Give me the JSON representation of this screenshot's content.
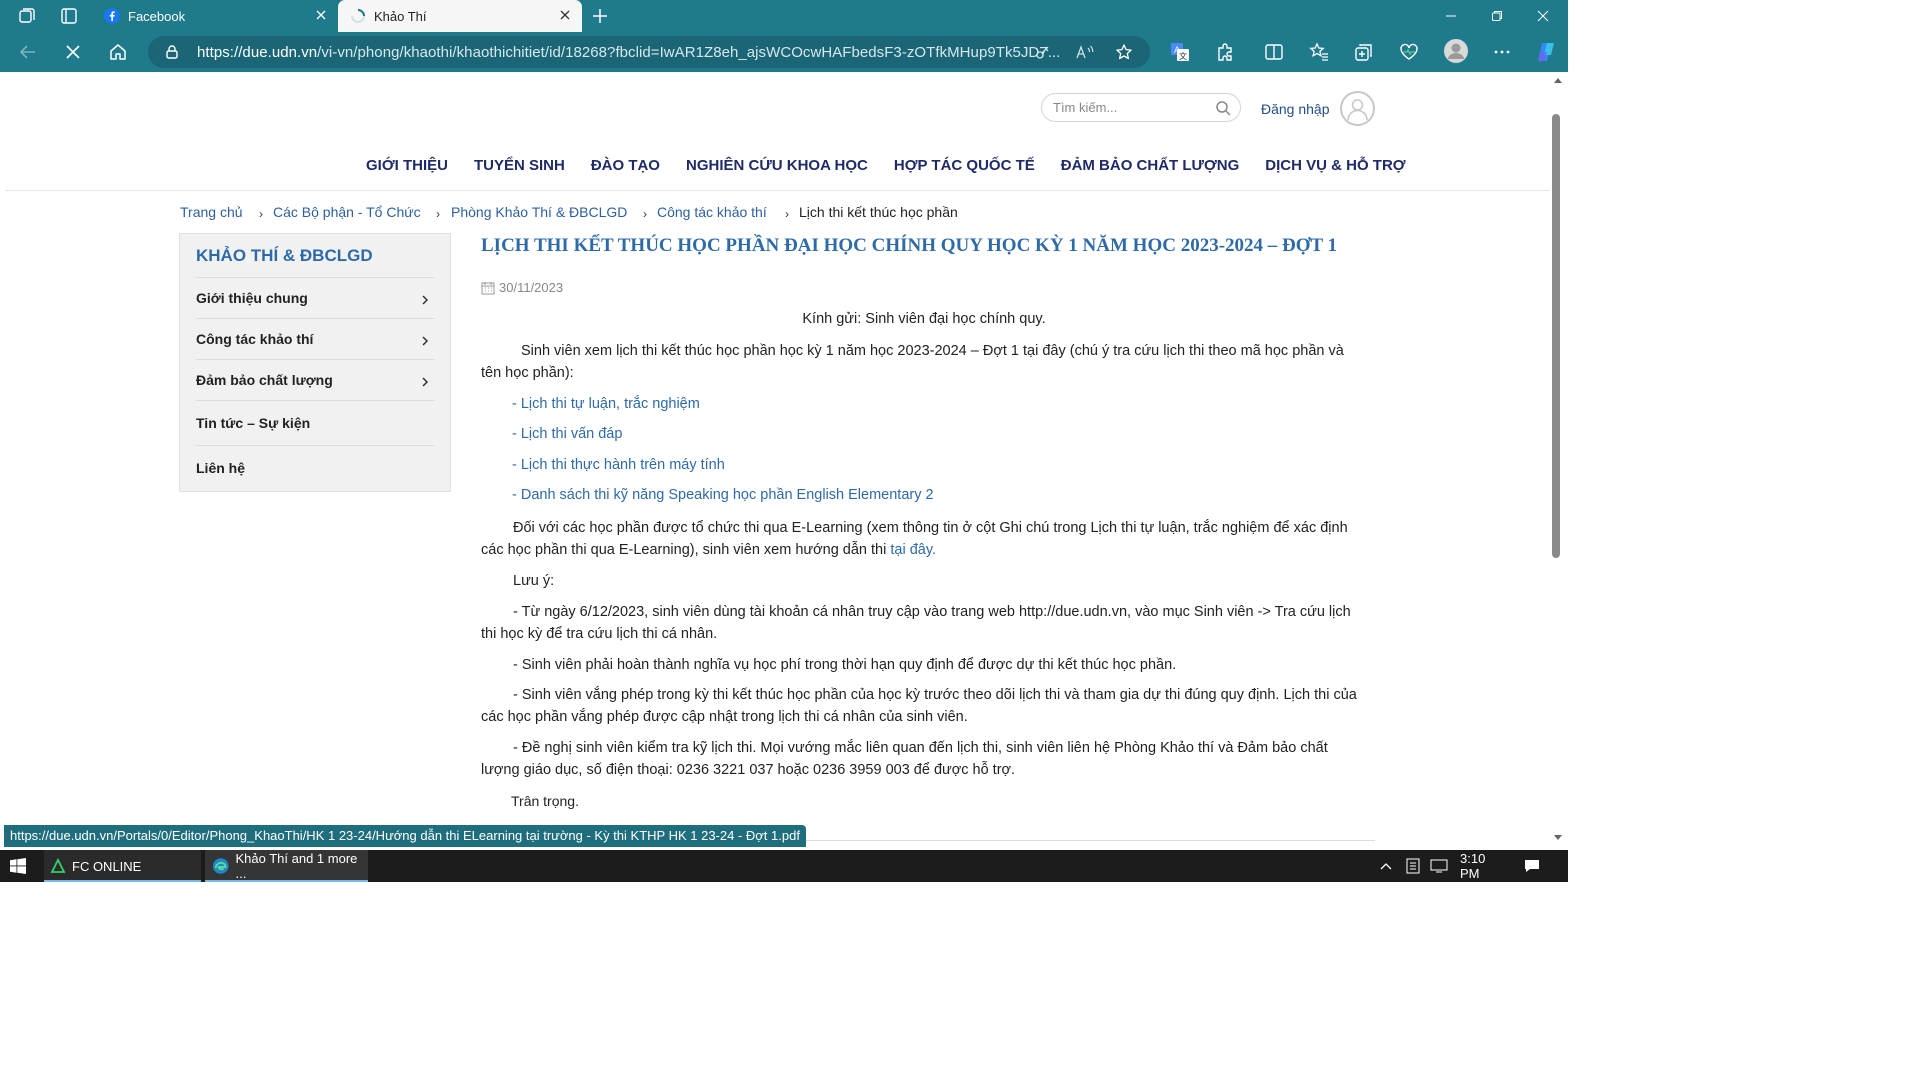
{
  "browser": {
    "tabs": [
      {
        "title": "Facebook"
      },
      {
        "title": "Khảo Thí"
      }
    ],
    "url_host": "https://due.udn.vn",
    "url_path": "/vi-vn/phong/khaothi/khaothichitiet/id/18268?fbclid=IwAR1Z8eh_ajsWCOcwHAFbedsF3-zOTfkMHup9Tk5JD7...",
    "status_url": "https://due.udn.vn/Portals/0/Editor/Phong_KhaoThi/HK 1 23-24/Hướng dẫn thi ELearning tại trường - Kỳ thi KTHP HK 1 23-24 - Đợt 1.pdf",
    "accent": "#1f7a8c"
  },
  "header": {
    "search_placeholder": "Tìm kiếm...",
    "login": "Đăng nhập",
    "menu": [
      "GIỚI THIỆU",
      "TUYỂN SINH",
      "ĐÀO TẠO",
      "NGHIÊN CỨU KHOA HỌC",
      "HỢP TÁC QUỐC TẾ",
      "ĐẢM BẢO CHẤT LƯỢNG",
      "DỊCH VỤ & HỖ TRỢ"
    ]
  },
  "breadcrumb": [
    "Trang chủ",
    "Các Bộ phận - Tổ Chức",
    "Phòng Khảo Thí & ĐBCLGD",
    "Công tác khảo thí",
    "Lịch thi kết thúc học phần"
  ],
  "sidebar": {
    "title": "KHẢO THÍ & ĐBCLGD",
    "items": [
      "Giới thiệu chung",
      "Công tác khảo thí",
      "Đảm bảo chất lượng",
      "Tin tức – Sự kiện",
      "Liên hệ"
    ]
  },
  "article": {
    "title": "LỊCH THI KẾT THÚC HỌC PHẦN ĐẠI HỌC CHÍNH QUY HỌC KỲ 1 NĂM HỌC 2023-2024 – ĐỢT 1",
    "date": "30/11/2023",
    "greeting": "Kính gửi: Sinh viên đại học chính quy.",
    "intro": "Sinh viên xem lịch thi kết thúc học phần học kỳ 1 năm học 2023-2024 – Đợt 1 tại đây (chú ý tra cứu lịch thi theo mã học phần và tên học phần):",
    "links": [
      "- Lịch thi tự luận, trắc nghiệm",
      "- Lịch thi vấn đáp",
      "- Lịch thi thực hành trên máy tính",
      "- Danh sách thi kỹ năng Speaking học phần English Elementary 2"
    ],
    "elearning_text": "Đối với các học phần được tổ chức thi qua E-Learning (xem thông tin ở cột Ghi chú trong Lịch thi tự luận, trắc nghiệm để xác định các học phần thi qua E-Learning), sinh viên xem hướng dẫn thi ",
    "elearning_link": "tại đây.",
    "note_label": "Lưu ý:",
    "notes": [
      "- Từ ngày 6/12/2023, sinh viên dùng tài khoản cá nhân truy cập vào trang web http://due.udn.vn, vào mục Sinh viên -> Tra cứu lịch thi học kỳ để tra cứu lịch thi cá nhân.",
      "- Sinh viên phải hoàn thành nghĩa vụ học phí trong thời hạn quy định để được dự thi kết thúc học phần.",
      "- Sinh viên vắng phép trong kỳ thi kết thúc học phần của học kỳ trước theo dõi lịch thi và tham gia dự thi đúng quy định. Lịch thi của các học phần vắng phép được cập nhật trong lịch thi cá nhân của sinh viên.",
      "- Đề nghị sinh viên kiểm tra kỹ lịch thi. Mọi vướng mắc liên quan đến lịch thi, sinh viên liên hệ Phòng Khảo thí và Đảm bảo chất lượng giáo dục, số điện thoại: 0236 3221 037 hoặc 0236 3959 003 để được hỗ trợ."
    ],
    "closing": "Trân trọng."
  },
  "taskbar": {
    "apps": [
      "FC ONLINE",
      "Khảo Thí and 1 more ..."
    ],
    "time": "3:10 PM"
  }
}
